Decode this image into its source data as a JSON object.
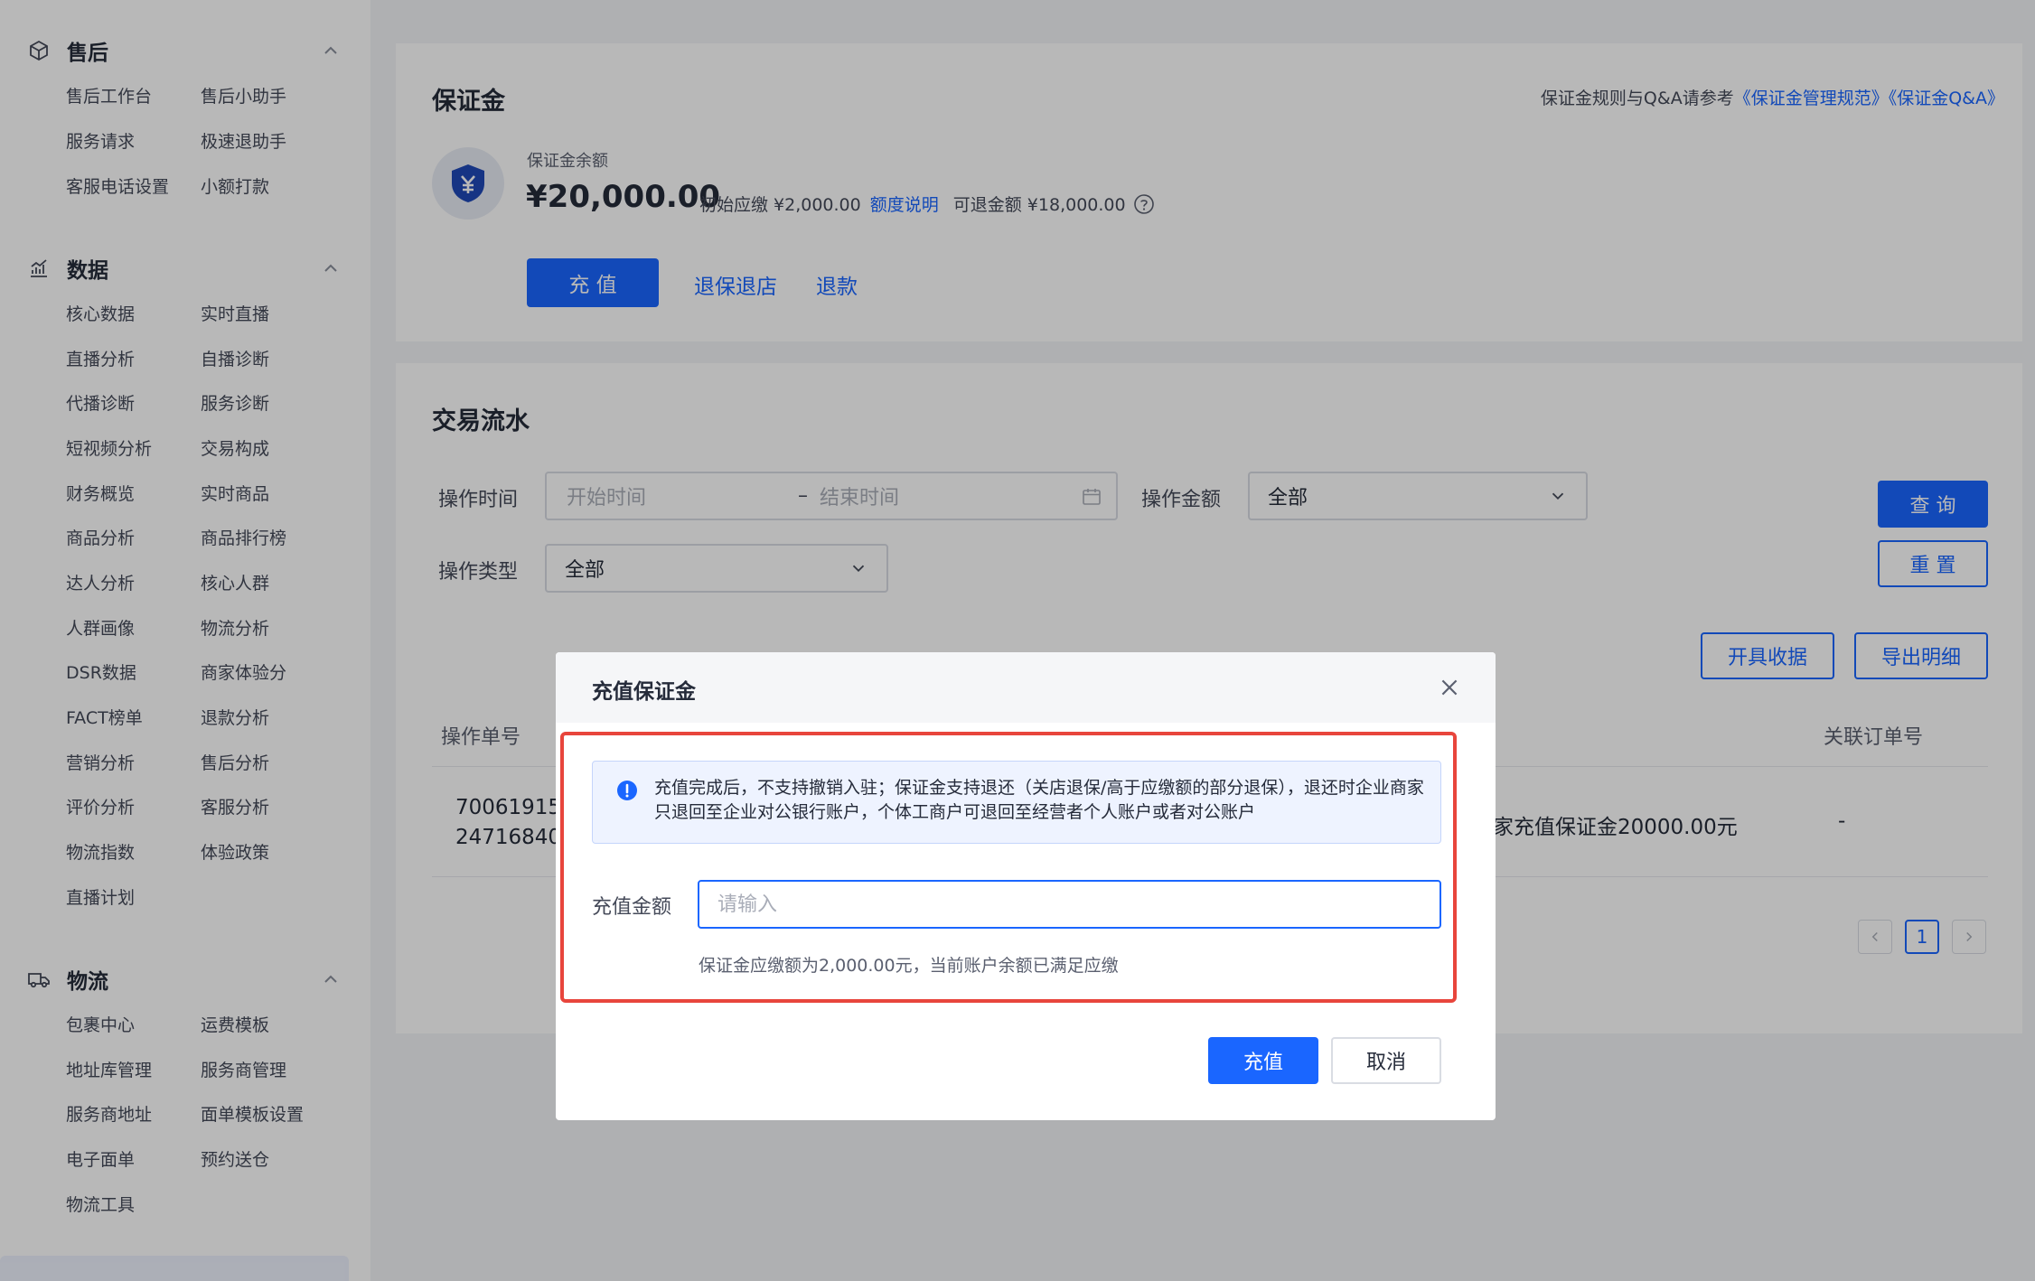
{
  "sidebar": {
    "groups": [
      {
        "title": "售后",
        "icon": "cube-icon",
        "items": [
          "售后工作台",
          "售后小助手",
          "服务请求",
          "极速退助手",
          "客服电话设置",
          "小额打款"
        ]
      },
      {
        "title": "数据",
        "icon": "chart-icon",
        "items": [
          "核心数据",
          "实时直播",
          "直播分析",
          "自播诊断",
          "代播诊断",
          "服务诊断",
          "短视频分析",
          "交易构成",
          "财务概览",
          "实时商品",
          "商品分析",
          "商品排行榜",
          "达人分析",
          "核心人群",
          "人群画像",
          "物流分析",
          "DSR数据",
          "商家体验分",
          "FACT榜单",
          "退款分析",
          "营销分析",
          "售后分析",
          "评价分析",
          "客服分析",
          "物流指数",
          "体验政策",
          "直播计划"
        ]
      },
      {
        "title": "物流",
        "icon": "truck-icon",
        "items": [
          "包裹中心",
          "运费模板",
          "地址库管理",
          "服务商管理",
          "服务商地址",
          "面单模板设置",
          "电子面单",
          "预约送仓",
          "物流工具"
        ]
      }
    ]
  },
  "deposit": {
    "title": "保证金",
    "rules_prefix": "保证金规则与Q&A请参考",
    "rules_link1": "《保证金管理规范》",
    "rules_link2": "《保证金Q&A》",
    "balance_label": "保证金余额",
    "balance": "¥20,000.00",
    "initial_due": "初始应缴 ¥2,000.00",
    "quota_link": "额度说明",
    "refundable": "可退金额 ¥18,000.00",
    "recharge_btn": "充 值",
    "withdraw_link": "退保退店",
    "refund_link": "退款"
  },
  "transactions": {
    "title": "交易流水",
    "op_time_label": "操作时间",
    "start_placeholder": "开始时间",
    "range_sep": "–",
    "end_placeholder": "结束时间",
    "op_amount_label": "操作金额",
    "op_amount_value": "全部",
    "op_type_label": "操作类型",
    "op_type_value": "全部",
    "query_btn": "查 询",
    "reset_btn": "重 置",
    "receipt_btn": "开具收据",
    "export_btn": "导出明细",
    "col_op_no": "操作单号",
    "col_related_order": "关联订单号",
    "row_id_line1": "70061915",
    "row_id_line2": "24716840",
    "row_desc": "家充值保证金20000.00元",
    "row_related": "-",
    "page_current": "1"
  },
  "modal": {
    "title": "充值保证金",
    "notice": "充值完成后，不支持撤销入驻；保证金支持退还（关店退保/高于应缴额的部分退保），退还时企业商家只退回至企业对公银行账户，个体工商户可退回至经营者个人账户或者对公账户",
    "amount_label": "充值金额",
    "amount_placeholder": "请输入",
    "hint": "保证金应缴额为2,000.00元，当前账户余额已满足应缴",
    "confirm_btn": "充值",
    "cancel_btn": "取消"
  },
  "colors": {
    "primary": "#1a66ff",
    "highlight": "#e8453c"
  }
}
